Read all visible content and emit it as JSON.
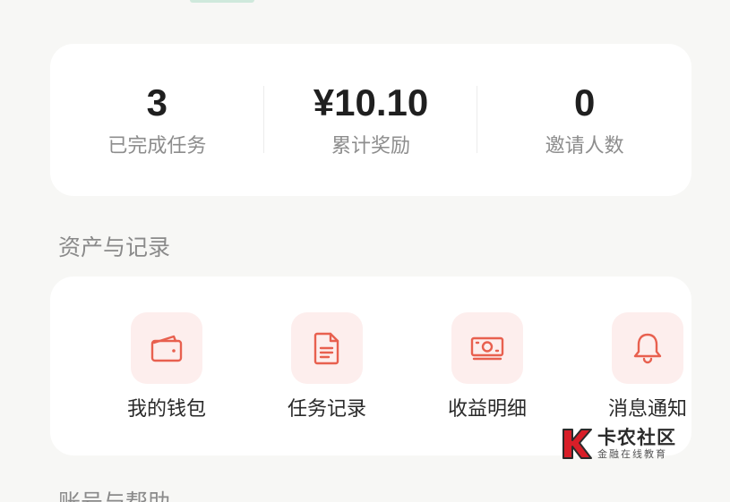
{
  "stats": [
    {
      "value": "3",
      "label": "已完成任务"
    },
    {
      "value": "¥10.10",
      "label": "累计奖励"
    },
    {
      "value": "0",
      "label": "邀请人数"
    }
  ],
  "sections": {
    "assets_title": "资产与记录",
    "account_title": "账号与帮助"
  },
  "features": [
    {
      "label": "我的钱包",
      "icon": "wallet-icon"
    },
    {
      "label": "任务记录",
      "icon": "document-icon"
    },
    {
      "label": "收益明细",
      "icon": "money-icon"
    },
    {
      "label": "消息通知",
      "icon": "bell-icon"
    }
  ],
  "watermark": {
    "main": "卡农社区",
    "sub": "金融在线教育"
  },
  "colors": {
    "accent": "#e8604f",
    "icon_bg": "#fdeeed",
    "card_bg": "#ffffff",
    "page_bg": "#f7f7f5"
  }
}
